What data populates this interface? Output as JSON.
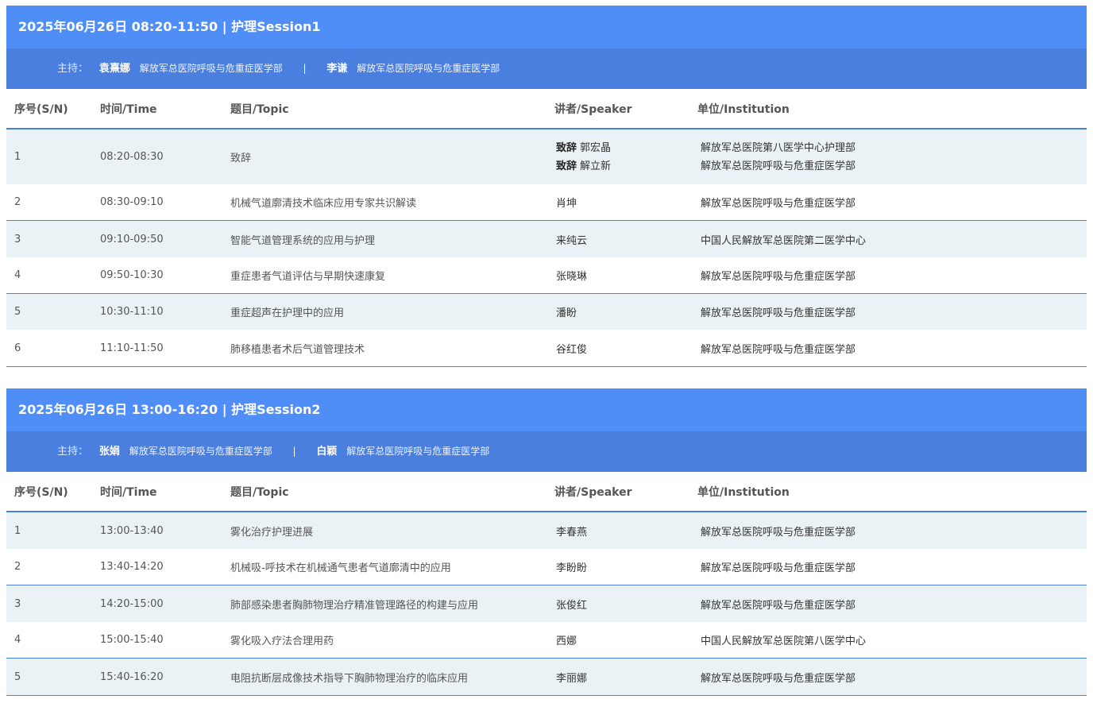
{
  "columns": {
    "sn": "序号(S/N)",
    "time": "时间/Time",
    "topic": "题目/Topic",
    "speaker": "讲者/Speaker",
    "institution": "单位/Institution"
  },
  "sessions": [
    {
      "title": "2025年06月26日 08:20-11:50 | 护理Session1",
      "host_label": "主持：",
      "hosts": [
        {
          "name": "袁熹娜",
          "org": "解放军总医院呼吸与危重症医学部"
        },
        {
          "name": "李谦",
          "org": "解放军总医院呼吸与危重症医学部"
        }
      ],
      "host_separator": "|",
      "rows": [
        {
          "sn": "1",
          "time": "08:20-08:30",
          "topic": "致辞",
          "speakers": [
            {
              "role": "致辞",
              "name": "郭宏晶"
            },
            {
              "role": "致辞",
              "name": "解立新"
            }
          ],
          "institutions": [
            "解放军总医院第八医学中心护理部",
            "解放军总医院呼吸与危重症医学部"
          ]
        },
        {
          "sn": "2",
          "time": "08:30-09:10",
          "topic": "机械气道廓清技术临床应用专家共识解读",
          "speaker": "肖坤",
          "institution": "解放军总医院呼吸与危重症医学部"
        },
        {
          "sn": "3",
          "time": "09:10-09:50",
          "topic": "智能气道管理系统的应用与护理",
          "speaker": "来纯云",
          "institution": "中国人民解放军总医院第二医学中心"
        },
        {
          "sn": "4",
          "time": "09:50-10:30",
          "topic": "重症患者气道评估与早期快速康复",
          "speaker": "张晓琳",
          "institution": "解放军总医院呼吸与危重症医学部"
        },
        {
          "sn": "5",
          "time": "10:30-11:10",
          "topic": "重症超声在护理中的应用",
          "speaker": "潘盼",
          "institution": "解放军总医院呼吸与危重症医学部"
        },
        {
          "sn": "6",
          "time": "11:10-11:50",
          "topic": "肺移植患者术后气道管理技术",
          "speaker": "谷红俊",
          "institution": "解放军总医院呼吸与危重症医学部"
        }
      ]
    },
    {
      "title": "2025年06月26日 13:00-16:20 | 护理Session2",
      "host_label": "主持：",
      "hosts": [
        {
          "name": "张娟",
          "org": "解放军总医院呼吸与危重症医学部"
        },
        {
          "name": "白颖",
          "org": "解放军总医院呼吸与危重症医学部"
        }
      ],
      "host_separator": "|",
      "rows": [
        {
          "sn": "1",
          "time": "13:00-13:40",
          "topic": "雾化治疗护理进展",
          "speaker": "李春燕",
          "institution": "解放军总医院呼吸与危重症医学部"
        },
        {
          "sn": "2",
          "time": "13:40-14:20",
          "topic": "机械吸-呼技术在机械通气患者气道廓清中的应用",
          "speaker": "李盼盼",
          "institution": "解放军总医院呼吸与危重症医学部"
        },
        {
          "sn": "3",
          "time": "14:20-15:00",
          "topic": "肺部感染患者胸肺物理治疗精准管理路径的构建与应用",
          "speaker": "张俊红",
          "institution": "解放军总医院呼吸与危重症医学部"
        },
        {
          "sn": "4",
          "time": "15:00-15:40",
          "topic": "雾化吸入疗法合理用药",
          "speaker": "西娜",
          "institution": "中国人民解放军总医院第八医学中心"
        },
        {
          "sn": "5",
          "time": "15:40-16:20",
          "topic": "电阻抗断层成像技术指导下胸肺物理治疗的临床应用",
          "speaker": "李丽娜",
          "institution": "解放军总医院呼吸与危重症医学部"
        }
      ]
    }
  ]
}
